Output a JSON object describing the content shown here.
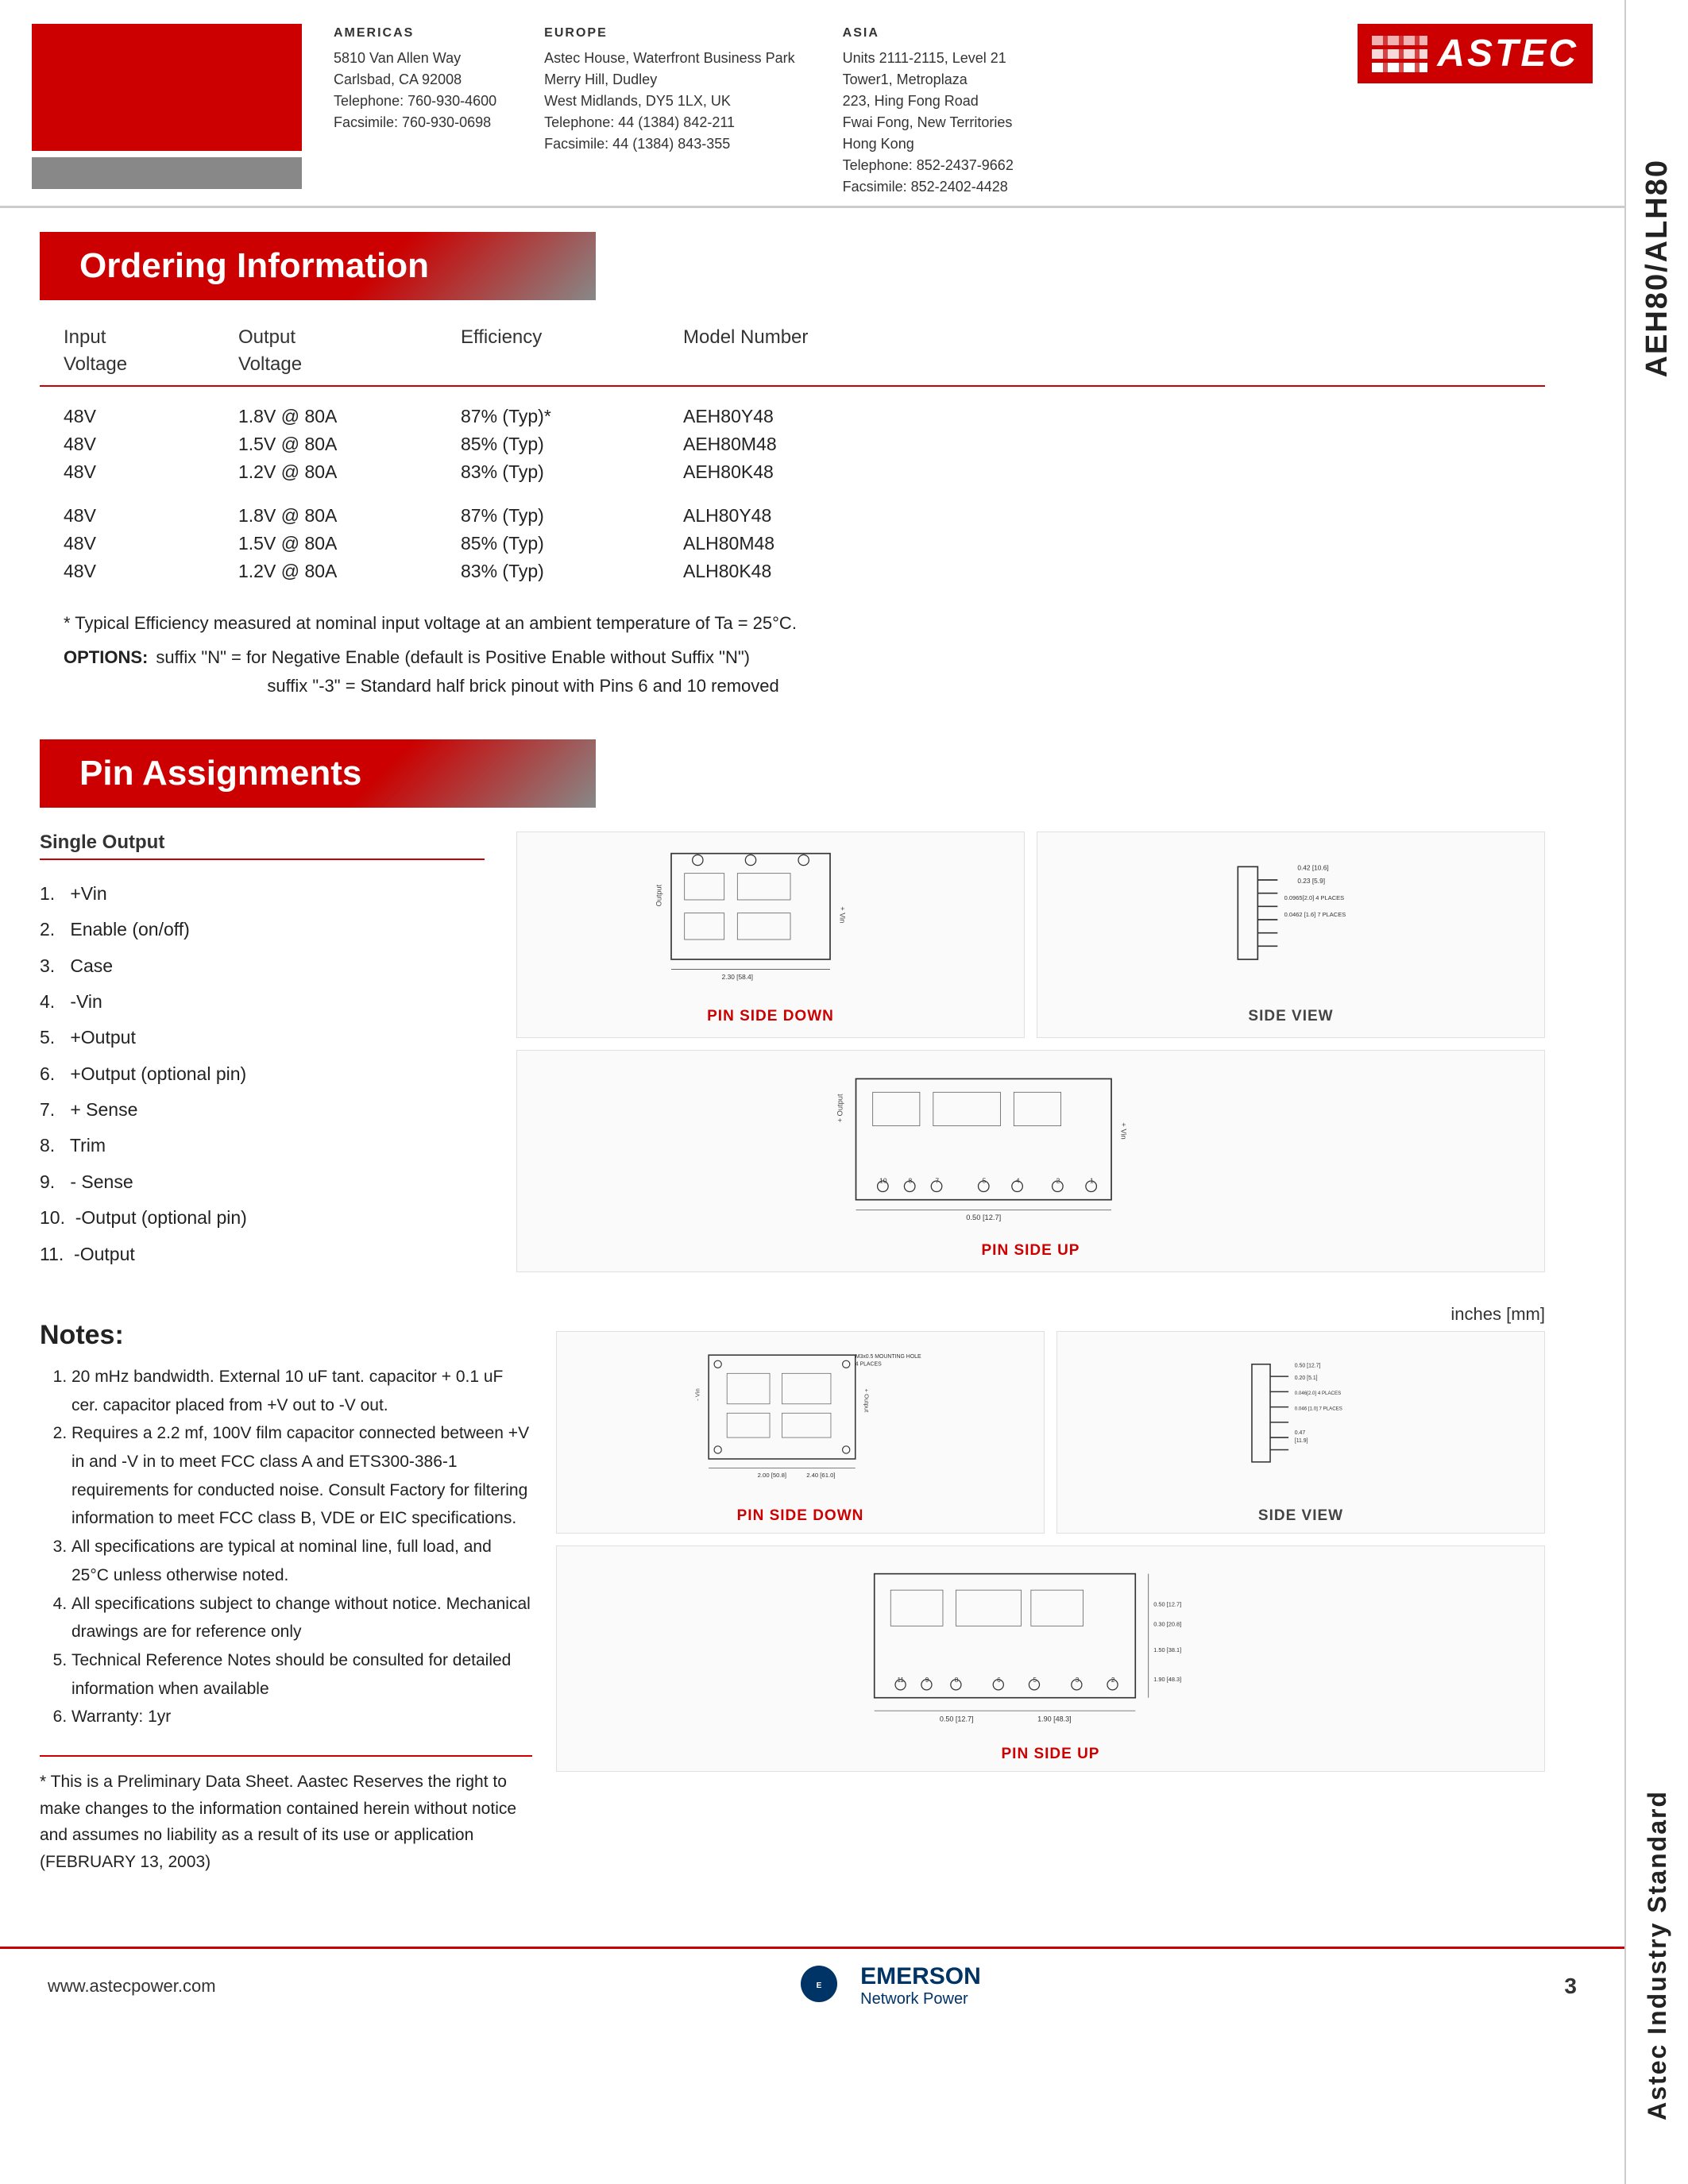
{
  "header": {
    "americas": {
      "title": "AMERICAS",
      "line1": "5810 Van Allen Way",
      "line2": "Carlsbad, CA 92008",
      "line3": "Telephone: 760-930-4600",
      "line4": "Facsimile: 760-930-0698"
    },
    "europe": {
      "title": "EUROPE",
      "line1": "Astec House, Waterfront Business Park",
      "line2": "Merry Hill, Dudley",
      "line3": "West Midlands, DY5 1LX, UK",
      "line4": "Telephone: 44 (1384) 842-211",
      "line5": "Facsimile: 44 (1384) 843-355"
    },
    "asia": {
      "title": "ASIA",
      "line1": "Units 2111-2115, Level 21",
      "line2": "Tower1, Metroplaza",
      "line3": "223, Hing Fong Road",
      "line4": "Fwai Fong, New Territories",
      "line5": "Hong Kong",
      "line6": "Telephone: 852-2437-9662",
      "line7": "Facsimile: 852-2402-4428"
    },
    "logo_text": "ASTEC",
    "model_vertical": "AEH80/ALH80",
    "industry_vertical": "Astec Industry Standard"
  },
  "ordering": {
    "section_title": "Ordering Information",
    "col1": "Input\nVoltage",
    "col2": "Output\nVoltage",
    "col3": "Efficiency",
    "col4": "Model Number",
    "groups": [
      {
        "rows": [
          {
            "input": "48V",
            "output": "1.8V @ 80A",
            "efficiency": "87% (Typ)*",
            "model": "AEH80Y48"
          },
          {
            "input": "48V",
            "output": "1.5V @ 80A",
            "efficiency": "85% (Typ)",
            "model": "AEH80M48"
          },
          {
            "input": "48V",
            "output": "1.2V @ 80A",
            "efficiency": "83% (Typ)",
            "model": "AEH80K48"
          }
        ]
      },
      {
        "rows": [
          {
            "input": "48V",
            "output": "1.8V @ 80A",
            "efficiency": "87% (Typ)",
            "model": "ALH80Y48"
          },
          {
            "input": "48V",
            "output": "1.5V @ 80A",
            "efficiency": "85% (Typ)",
            "model": "ALH80M48"
          },
          {
            "input": "48V",
            "output": "1.2V @ 80A",
            "efficiency": "83% (Typ)",
            "model": "ALH80K48"
          }
        ]
      }
    ],
    "footnote1": "* Typical Efficiency measured at nominal input voltage at an ambient temperature of Ta = 25°C.",
    "footnote2_label": "OPTIONS:",
    "footnote2a": "suffix \"N\" = for Negative Enable (default is Positive Enable without Suffix \"N\")",
    "footnote2b": "suffix \"-3\" = Standard half brick pinout with Pins 6 and 10 removed"
  },
  "pin_assignments": {
    "section_title": "Pin Assignments",
    "subheader": "Single Output",
    "pins": [
      {
        "num": "1.",
        "label": "+Vin"
      },
      {
        "num": "2.",
        "label": "Enable (on/off)"
      },
      {
        "num": "3.",
        "label": "Case"
      },
      {
        "num": "4.",
        "label": "-Vin"
      },
      {
        "num": "5.",
        "label": "+Output"
      },
      {
        "num": "6.",
        "label": "+Output (optional pin)"
      },
      {
        "num": "7.",
        "label": "+ Sense"
      },
      {
        "num": "8.",
        "label": "Trim"
      },
      {
        "num": "9.",
        "label": "- Sense"
      },
      {
        "num": "10.",
        "label": "-Output (optional pin)"
      },
      {
        "num": "11.",
        "label": "-Output"
      }
    ],
    "diagrams": [
      {
        "id": "top-left",
        "label": "PIN SIDE DOWN",
        "type": "main"
      },
      {
        "id": "top-right",
        "label": "SIDE VIEW",
        "type": "side"
      },
      {
        "id": "bottom-left",
        "label": "PIN SIDE UP",
        "type": "main"
      }
    ]
  },
  "notes": {
    "title": "Notes:",
    "items": [
      "20 mHz bandwidth. External 10 uF tant. capacitor + 0.1 uF cer. capacitor placed from +V out to -V out.",
      "Requires a 2.2 mf, 100V film capacitor connected between +V in and -V in to meet FCC class A and ETS300-386-1 requirements for conducted noise. Consult Factory for filtering information to meet FCC class B, VDE or EIC specifications.",
      "All specifications are typical at nominal line, full load, and 25°C unless otherwise noted.",
      "All specifications subject to change without notice. Mechanical drawings are for reference only",
      "Technical Reference Notes should be consulted for detailed information when available",
      "Warranty: 1yr"
    ]
  },
  "diagrams_lower": [
    {
      "id": "lower-top-left",
      "label": "PIN SIDE DOWN",
      "type": "main2"
    },
    {
      "id": "lower-top-right",
      "label": "SIDE VIEW",
      "type": "side2"
    },
    {
      "id": "lower-bottom",
      "label": "PIN SIDE UP",
      "type": "main2"
    }
  ],
  "inches_label": "inches [mm]",
  "preliminary": {
    "text": "* This is a Preliminary Data Sheet. Aastec Reserves the right to make changes to the information contained herein without notice and assumes no liability as a result of its use or application (FEBRUARY 13, 2003)"
  },
  "footer": {
    "url": "www.astecpower.com",
    "company": "EMERSON",
    "subtitle": "Network Power",
    "page": "3"
  }
}
